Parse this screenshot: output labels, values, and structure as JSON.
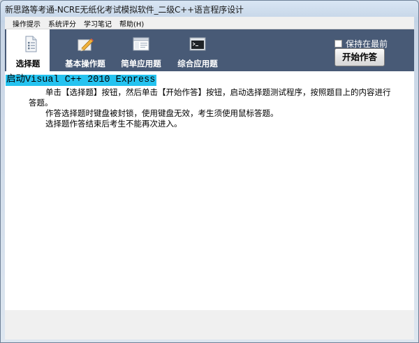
{
  "window": {
    "title": "新思路等考通-NCRE无纸化考试模拟软件_二级C++语言程序设计"
  },
  "menu": [
    {
      "label": "操作提示"
    },
    {
      "label": "系统评分"
    },
    {
      "label": "学习笔记"
    },
    {
      "label": "帮助(H)"
    }
  ],
  "tabs": [
    {
      "label": "选择题",
      "icon": "document-icon",
      "active": true
    },
    {
      "label": "基本操作题",
      "icon": "edit-icon",
      "active": false
    },
    {
      "label": "简单应用题",
      "icon": "window-icon",
      "active": false
    },
    {
      "label": "综合应用题",
      "icon": "console-icon",
      "active": false
    }
  ],
  "options": {
    "keep_on_top_label": "保持在最前",
    "keep_on_top_checked": false
  },
  "actions": {
    "start_label": "开始作答"
  },
  "content": {
    "heading": "启动Visual C++ 2010 Express",
    "para1_line1": "单击【选择题】按钮，然后单击【开始作答】按钮，启动选择题测试程序，按照题目上的内容进行",
    "para1_line2": "答题。",
    "para2": "作答选择题时键盘被封锁，使用键盘无效，考生须使用鼠标答题。",
    "para3": "选择题作答结束后考生不能再次进入。"
  }
}
